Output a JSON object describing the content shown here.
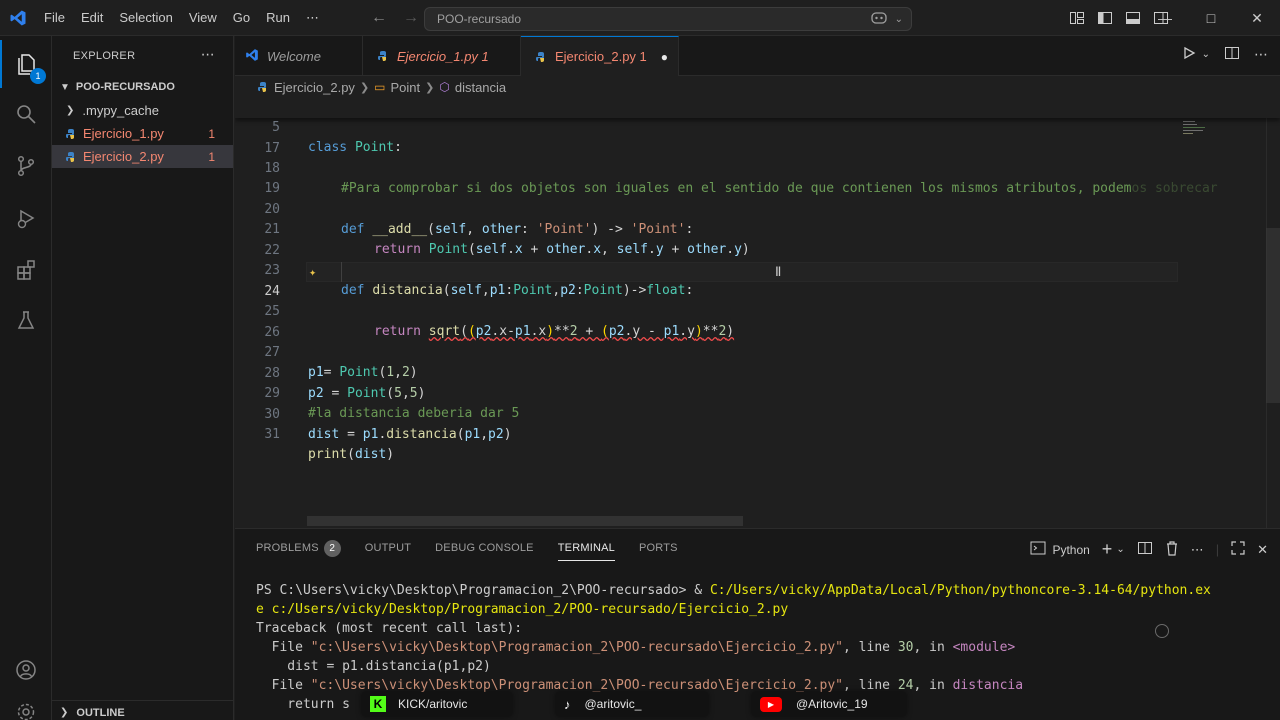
{
  "titlebar": {
    "menus": [
      "File",
      "Edit",
      "Selection",
      "View",
      "Go",
      "Run",
      "⋯"
    ],
    "search": "POO-recursado"
  },
  "activity": {
    "explorer_badge": "1"
  },
  "sidebar": {
    "header": "EXPLORER",
    "folder": "POO-RECURSADO",
    "items": [
      {
        "label": ".mypy_cache",
        "count": ""
      },
      {
        "label": "Ejercicio_1.py",
        "count": "1"
      },
      {
        "label": "Ejercicio_2.py",
        "count": "1"
      }
    ],
    "outline": "OUTLINE"
  },
  "tabs": [
    {
      "label": "Welcome"
    },
    {
      "label": "Ejercicio_1.py 1"
    },
    {
      "label": "Ejercicio_2.py 1"
    }
  ],
  "breadcrumbs": [
    "Ejercicio_2.py",
    "Point",
    "distancia"
  ],
  "editor": {
    "sticky": {
      "num": "5",
      "text": "class Point:"
    },
    "line_numbers": [
      "17",
      "18",
      "19",
      "20",
      "21",
      "22",
      "23",
      "24",
      "25",
      "26",
      "27",
      "28",
      "29",
      "30",
      "31"
    ],
    "comment18": "#Para comprobar si dos objetos son iguales en el sentido de que contienen los mismos atributos, podem",
    "comment18_faded": "os sobrecar",
    "comment29": "#la distancia deberia dar 5"
  },
  "panel": {
    "tabs": [
      "PROBLEMS",
      "OUTPUT",
      "DEBUG CONSOLE",
      "TERMINAL",
      "PORTS"
    ],
    "problems_count": "2",
    "shell": "Python"
  },
  "terminal": {
    "l1a": "PS C:\\Users\\vicky\\Desktop\\Programacion_2\\POO-recursado> & ",
    "l1b": "C:/Users/vicky/AppData/Local/Python/pythoncore-3.14-64/python.ex",
    "l2": "e c:/Users/vicky/Desktop/Programacion_2/POO-recursado/Ejercicio_2.py",
    "l3": "Traceback (most recent call last):",
    "l4a": "  File ",
    "l4b": "\"c:\\Users\\vicky\\Desktop\\Programacion_2\\POO-recursado\\Ejercicio_2.py\"",
    "l4c": ", line ",
    "l4d": "30",
    "l4e": ", in ",
    "l4f": "<module>",
    "l5": "    dist = p1.distancia(p1,p2)",
    "l6a": "  File ",
    "l6b": "\"c:\\Users\\vicky\\Desktop\\Programacion_2\\POO-recursado\\Ejercicio_2.py\"",
    "l6c": ", line ",
    "l6d": "24",
    "l6e": ", in ",
    "l6f": "distancia",
    "l7": "    return s"
  },
  "overlays": [
    {
      "label": "KICK/aritovic"
    },
    {
      "label": "@aritovic_"
    },
    {
      "label": "@Aritovic_19"
    }
  ],
  "colors": {
    "accent": "#0078d4",
    "kick": "#53fc18",
    "youtube": "#ff0000"
  }
}
